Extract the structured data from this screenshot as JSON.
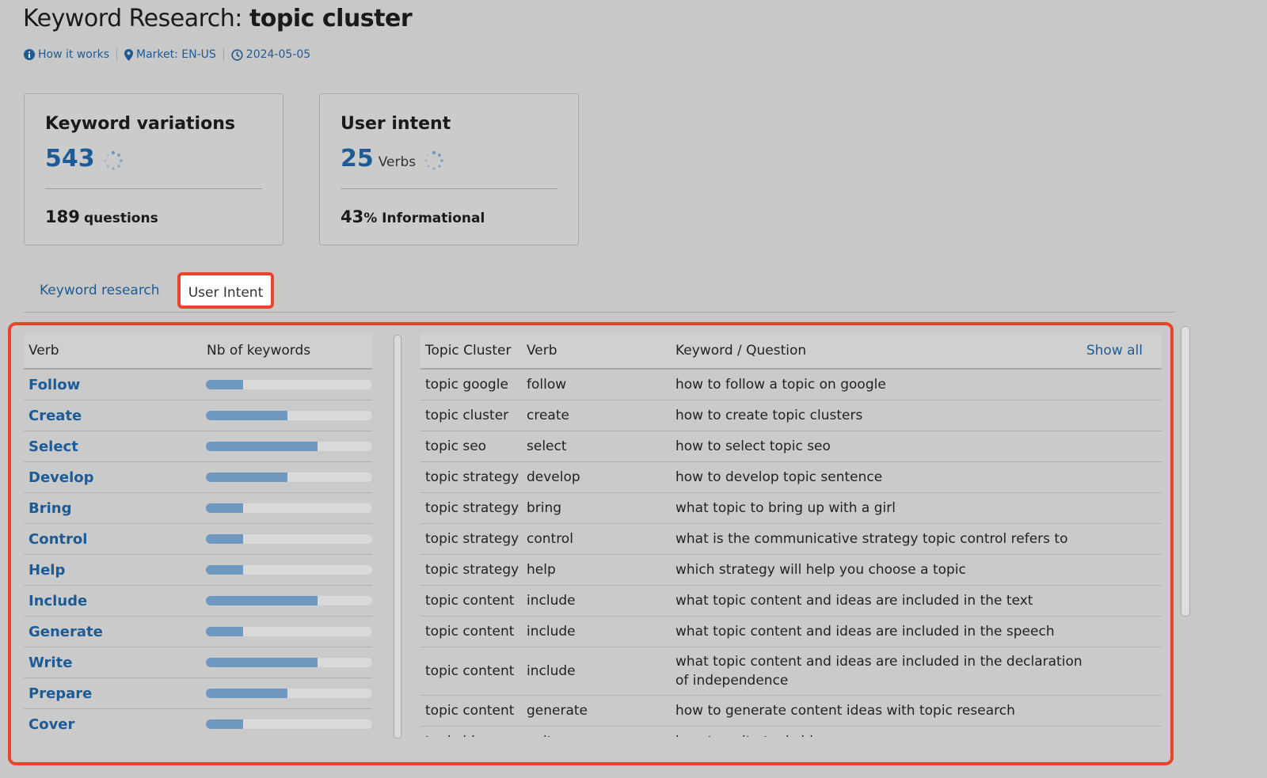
{
  "header": {
    "title_prefix": "Keyword Research:",
    "query": "topic cluster",
    "meta": {
      "how_it_works": "How it works",
      "market": "Market: EN-US",
      "date": "2024-05-05"
    }
  },
  "cards": {
    "variations": {
      "title": "Keyword variations",
      "value": "543",
      "sub_value": "189",
      "sub_label": "questions"
    },
    "intent": {
      "title": "User intent",
      "value": "25",
      "unit": "Verbs",
      "sub_value": "43",
      "sub_label": "% Informational"
    }
  },
  "tabs": {
    "keyword_research": "Keyword research",
    "user_intent": "User Intent"
  },
  "verbs_table": {
    "headers": {
      "verb": "Verb",
      "nb": "Nb of keywords"
    },
    "rows": [
      {
        "verb": "Follow",
        "level": 0.22
      },
      {
        "verb": "Create",
        "level": 0.49
      },
      {
        "verb": "Select",
        "level": 0.67
      },
      {
        "verb": "Develop",
        "level": 0.49
      },
      {
        "verb": "Bring",
        "level": 0.22
      },
      {
        "verb": "Control",
        "level": 0.22
      },
      {
        "verb": "Help",
        "level": 0.22
      },
      {
        "verb": "Include",
        "level": 0.67
      },
      {
        "verb": "Generate",
        "level": 0.22
      },
      {
        "verb": "Write",
        "level": 0.67
      },
      {
        "verb": "Prepare",
        "level": 0.49
      },
      {
        "verb": "Cover",
        "level": 0.22
      }
    ]
  },
  "keywords_table": {
    "headers": {
      "topic": "Topic Cluster",
      "verb": "Verb",
      "keyword": "Keyword / Question",
      "show_all": "Show all"
    },
    "rows": [
      {
        "topic": "topic google",
        "verb": "follow",
        "keyword": "how to follow a topic on google"
      },
      {
        "topic": "topic cluster",
        "verb": "create",
        "keyword": "how to create topic clusters"
      },
      {
        "topic": "topic seo",
        "verb": "select",
        "keyword": "how to select topic seo"
      },
      {
        "topic": "topic strategy",
        "verb": "develop",
        "keyword": "how to develop topic sentence"
      },
      {
        "topic": "topic strategy",
        "verb": "bring",
        "keyword": "what topic to bring up with a girl"
      },
      {
        "topic": "topic strategy",
        "verb": "control",
        "keyword": "what is the communicative strategy topic control refers to"
      },
      {
        "topic": "topic strategy",
        "verb": "help",
        "keyword": "which strategy will help you choose a topic"
      },
      {
        "topic": "topic content",
        "verb": "include",
        "keyword": "what topic content and ideas are included in the text"
      },
      {
        "topic": "topic content",
        "verb": "include",
        "keyword": "what topic content and ideas are included in the speech"
      },
      {
        "topic": "topic content",
        "verb": "include",
        "keyword": "what topic content and ideas are included in the declaration of independence"
      },
      {
        "topic": "topic content",
        "verb": "generate",
        "keyword": "how to generate content ideas with topic research"
      },
      {
        "topic": "topic ideas",
        "verb": "write",
        "keyword": "how to write topic ideas"
      }
    ]
  },
  "colors": {
    "accent": "#1d5b96",
    "highlight": "#e8452c",
    "bar": "#6f98c1"
  }
}
